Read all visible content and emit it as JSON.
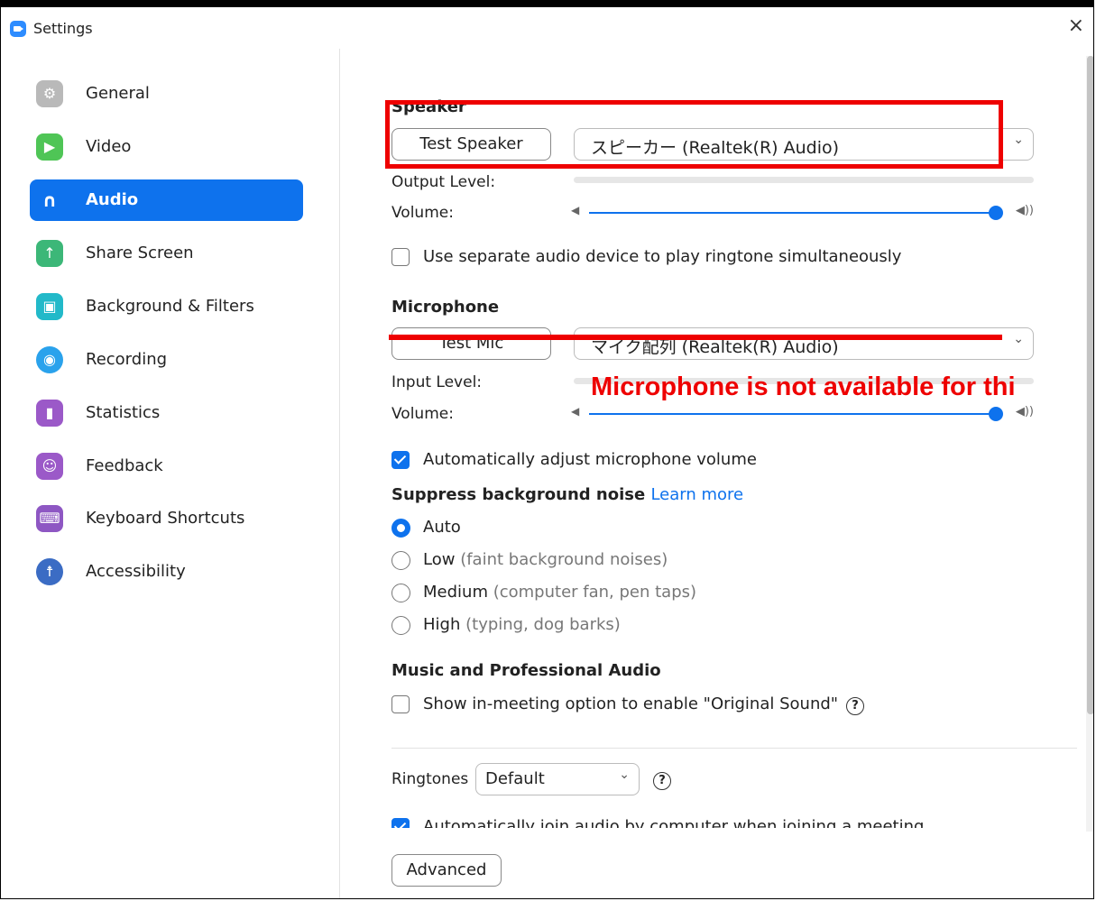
{
  "window": {
    "title": "Settings",
    "close_symbol": "×"
  },
  "sidebar": {
    "items": [
      {
        "label": "General",
        "icon": "gear-icon",
        "color": "#b9b9b9",
        "glyph": "⚙"
      },
      {
        "label": "Video",
        "icon": "video-camera-icon",
        "color": "#4fc556",
        "glyph": "▶"
      },
      {
        "label": "Audio",
        "icon": "headphones-icon",
        "color": "#0e72ed",
        "glyph": "∩",
        "active": true
      },
      {
        "label": "Share Screen",
        "icon": "share-screen-icon",
        "color": "#3cb778",
        "glyph": "↑"
      },
      {
        "label": "Background & Filters",
        "icon": "background-icon",
        "color": "#22b9c9",
        "glyph": "▣"
      },
      {
        "label": "Recording",
        "icon": "recording-icon",
        "color": "#2aa2ec",
        "glyph": "◉"
      },
      {
        "label": "Statistics",
        "icon": "statistics-icon",
        "color": "#9b59c8",
        "glyph": "▮"
      },
      {
        "label": "Feedback",
        "icon": "feedback-icon",
        "color": "#9b59c8",
        "glyph": "☺"
      },
      {
        "label": "Keyboard Shortcuts",
        "icon": "keyboard-icon",
        "color": "#8e57c3",
        "glyph": "⌨"
      },
      {
        "label": "Accessibility",
        "icon": "accessibility-icon",
        "color": "#3b6cc4",
        "glyph": "☨"
      }
    ]
  },
  "speaker": {
    "heading": "Speaker",
    "test_button": "Test Speaker",
    "device": "スピーカー (Realtek(R) Audio)",
    "output_level_label": "Output Level:",
    "volume_label": "Volume:",
    "volume_level": 1.0
  },
  "ringtone_separate": {
    "label": "Use separate audio device to play ringtone simultaneously",
    "checked": false
  },
  "microphone": {
    "heading": "Microphone",
    "test_button": "Test Mic",
    "device": "マイク配列 (Realtek(R) Audio)",
    "input_level_label": "Input Level:",
    "volume_label": "Volume:",
    "volume_level": 1.0,
    "auto_adjust": {
      "label": "Automatically adjust microphone volume",
      "checked": true
    }
  },
  "noise": {
    "heading": "Suppress background noise",
    "learn_more": "Learn more",
    "options": [
      {
        "label": "Auto",
        "hint": "",
        "checked": true
      },
      {
        "label": "Low",
        "hint": "(faint background noises)",
        "checked": false
      },
      {
        "label": "Medium",
        "hint": "(computer fan, pen taps)",
        "checked": false
      },
      {
        "label": "High",
        "hint": "(typing, dog barks)",
        "checked": false
      }
    ]
  },
  "music": {
    "heading": "Music and Professional Audio",
    "original_sound": {
      "label": "Show in-meeting option to enable \"Original Sound\"",
      "checked": false
    }
  },
  "ringtones": {
    "label": "Ringtones",
    "value": "Default"
  },
  "auto_join": {
    "label": "Automatically join audio by computer when joining a meeting",
    "checked": true
  },
  "advanced_button": "Advanced",
  "annotation": {
    "warning": "Microphone is not available for thi",
    "color": "#e00000"
  }
}
